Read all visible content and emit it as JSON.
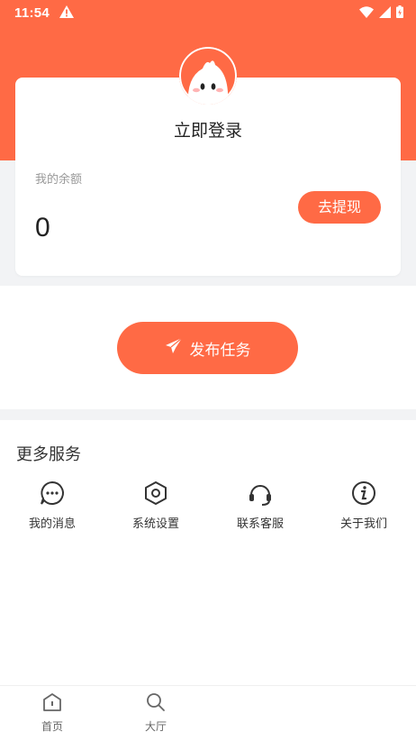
{
  "status_bar": {
    "time": "11:54",
    "icons": [
      "warning-icon",
      "wifi-icon",
      "signal-icon",
      "battery-icon"
    ]
  },
  "colors": {
    "accent": "#ff6a45",
    "background": "#f2f3f5"
  },
  "profile": {
    "login_label": "立即登录",
    "balance_label": "我的余额",
    "balance_value": "0",
    "withdraw_label": "去提现"
  },
  "publish": {
    "label": "发布任务",
    "icon": "paper-plane-icon"
  },
  "services": {
    "title": "更多服务",
    "items": [
      {
        "label": "我的消息",
        "icon": "chat-bubble-icon"
      },
      {
        "label": "系统设置",
        "icon": "settings-hex-icon"
      },
      {
        "label": "联系客服",
        "icon": "headset-icon"
      },
      {
        "label": "关于我们",
        "icon": "info-icon"
      }
    ]
  },
  "tabbar": {
    "items": [
      {
        "label": "首页",
        "icon": "home-icon"
      },
      {
        "label": "大厅",
        "icon": "search-icon"
      }
    ]
  }
}
